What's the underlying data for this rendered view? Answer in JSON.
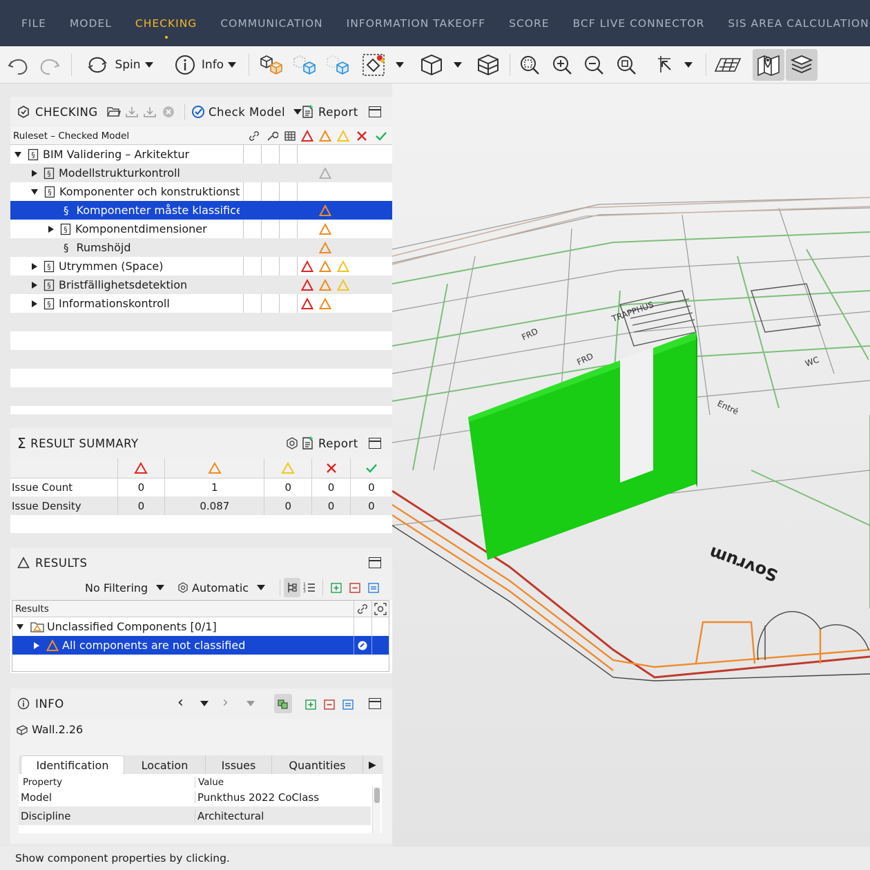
{
  "menu": {
    "items": [
      "FILE",
      "MODEL",
      "CHECKING",
      "COMMUNICATION",
      "INFORMATION TAKEOFF",
      "SCORE",
      "BCF LIVE CONNECTOR",
      "SIS AREA CALCULATION"
    ],
    "active": "CHECKING"
  },
  "toolbar": {
    "spin_label": "Spin",
    "info_label": "Info"
  },
  "checking": {
    "title": "CHECKING",
    "check_model_label": "Check Model",
    "report_label": "Report",
    "column_header": "Ruleset – Checked Model",
    "rows": [
      {
        "label": "BIM Validering – Arkitektur"
      },
      {
        "label": "Modellstrukturkontroll"
      },
      {
        "label": "Komponenter och konstruktionsty"
      },
      {
        "label": "Komponenter måste klassificer"
      },
      {
        "label": "Komponentdimensioner"
      },
      {
        "label": "Rumshöjd"
      },
      {
        "label": "Utrymmen (Space)"
      },
      {
        "label": "Bristfällighetsdetektion"
      },
      {
        "label": "Informationskontroll"
      }
    ]
  },
  "summary": {
    "title": "RESULT SUMMARY",
    "report_label": "Report",
    "rows": [
      {
        "label": "Issue Count",
        "values": [
          "0",
          "1",
          "0",
          "0",
          "0"
        ]
      },
      {
        "label": "Issue Density",
        "values": [
          "0",
          "0.087",
          "0",
          "0",
          "0"
        ]
      }
    ]
  },
  "results": {
    "title": "RESULTS",
    "filter_label": "No Filtering",
    "mode_label": "Automatic",
    "column_header": "Results",
    "group_label": "Unclassified Components [0/1]",
    "item_label": "All components are not classified"
  },
  "info": {
    "title": "INFO",
    "component_name": "Wall.2.26",
    "tabs": [
      "Identification",
      "Location",
      "Issues",
      "Quantities"
    ],
    "property_header": "Property",
    "value_header": "Value",
    "properties": [
      {
        "property": "Model",
        "value": "Punkthus 2022 CoClass"
      },
      {
        "property": "Discipline",
        "value": "Architectural"
      }
    ]
  },
  "viewport": {
    "room_label": "Sovrum",
    "highlight_color": "#19cc14"
  },
  "status": {
    "text": "Show component properties by clicking."
  },
  "colors": {
    "menu_bg": "#313b4f",
    "menu_active": "#f2b823",
    "selection": "#1748d4",
    "critical": "#e02424",
    "major": "#f08c1e",
    "moderate": "#f2c521",
    "rejected": "#e02424",
    "accepted": "#1fb55c"
  }
}
